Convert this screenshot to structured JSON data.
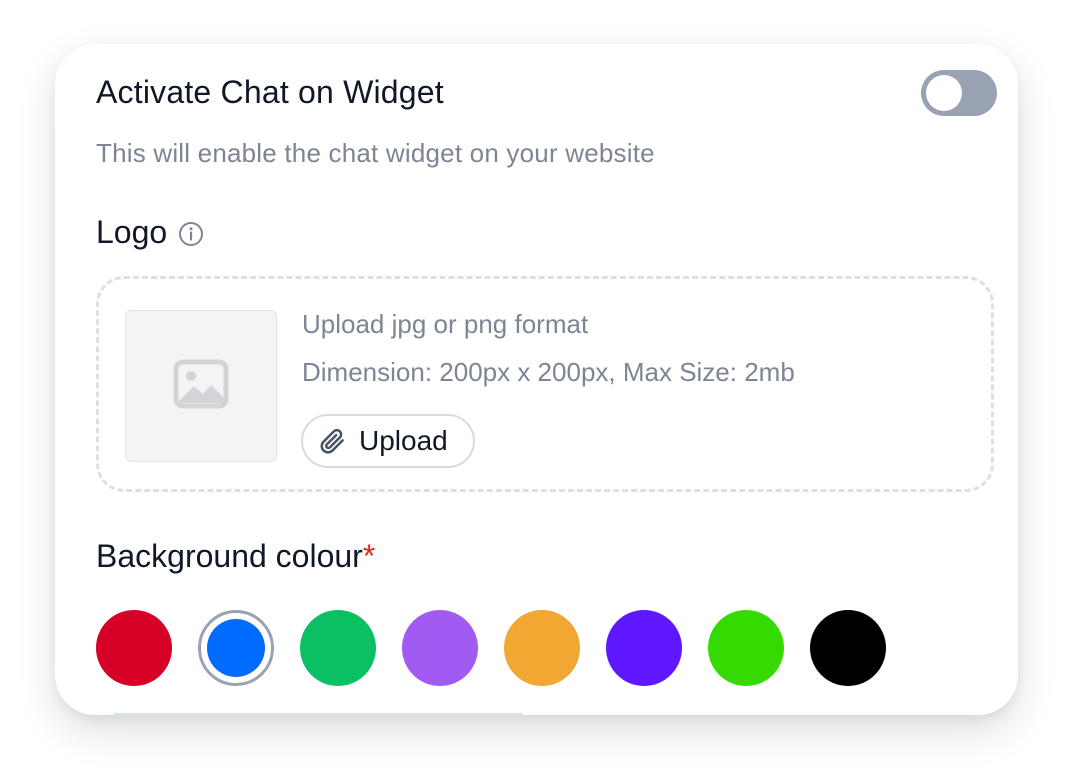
{
  "chat": {
    "title": "Activate Chat on Widget",
    "description": "This will enable the chat widget on your website",
    "toggle_on": false
  },
  "logo": {
    "label": "Logo",
    "info_icon": "info-circle-icon",
    "upload_hint": "Upload jpg or png format",
    "dimension_hint": "Dimension: 200px x 200px, Max Size: 2mb",
    "upload_button_label": "Upload",
    "upload_icon": "paperclip-icon",
    "placeholder_icon": "image-placeholder-icon"
  },
  "background": {
    "label": "Background colour",
    "required_marker": "*",
    "selected_index": 1,
    "colors": [
      "#D70026",
      "#006BFF",
      "#0BBF63",
      "#A15AF2",
      "#F1A732",
      "#5E17FF",
      "#35DB00",
      "#000000"
    ]
  },
  "theme": {
    "toggle_off_color": "#98A2B3",
    "required_color": "#D92D20"
  }
}
